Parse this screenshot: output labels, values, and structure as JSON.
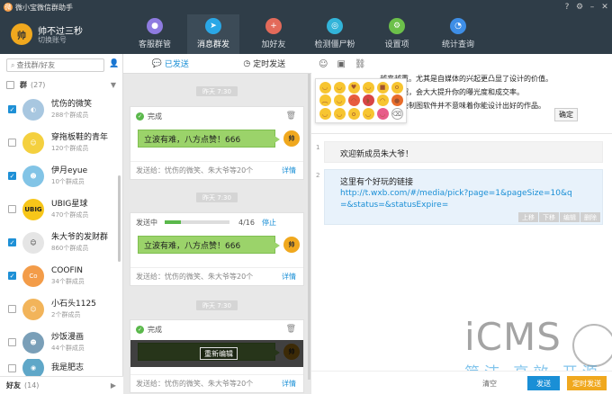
{
  "app": {
    "title": "微小宝微信群助手",
    "logo": "微"
  },
  "user": {
    "name": "帅不过三秒",
    "switch_label": "切换账号"
  },
  "nav": [
    {
      "label": "客服群管",
      "icon": "person-icon",
      "color": "#8e7be0"
    },
    {
      "label": "消息群发",
      "icon": "send-icon",
      "color": "#2aa7e6"
    },
    {
      "label": "加好友",
      "icon": "add-friend-icon",
      "color": "#e36a5a"
    },
    {
      "label": "检测僵尸粉",
      "icon": "scan-icon",
      "color": "#32b4d9"
    },
    {
      "label": "设置项",
      "icon": "gear-icon",
      "color": "#6cc04a"
    },
    {
      "label": "统计查询",
      "icon": "pie-chart-icon",
      "color": "#3e8ee6"
    }
  ],
  "sidebar": {
    "search_placeholder": "查找群/好友",
    "group_head": {
      "label": "群",
      "count": "(27)"
    },
    "groups": [
      {
        "name": "忧伤的微笑",
        "members": "288个群成员",
        "checked": true,
        "color": "#a8c7e0"
      },
      {
        "name": "穿拖板鞋的青年",
        "members": "120个群成员",
        "checked": false,
        "color": "#f4d03f"
      },
      {
        "name": "伊月eyue",
        "members": "10个群成员",
        "checked": true,
        "color": "#82c4e6"
      },
      {
        "name": "UBIG星球",
        "members": "470个群成员",
        "checked": false,
        "color": "#f7c619"
      },
      {
        "name": "朱大爷的发财群",
        "members": "860个群成员",
        "checked": true,
        "color": "#e5e5e5"
      },
      {
        "name": "COOFIN",
        "members": "34个群成员",
        "checked": true,
        "color": "#f39c49"
      },
      {
        "name": "小石头1125",
        "members": "2个群成员",
        "checked": false,
        "color": "#f2b45a"
      },
      {
        "name": "炒饭漫画",
        "members": "44个群成员",
        "checked": false,
        "color": "#7a9fb8"
      },
      {
        "name": "我是肥志",
        "members": "",
        "checked": false,
        "color": "#5fa7c8"
      }
    ],
    "friends_head": {
      "label": "好友",
      "count": "(14)"
    }
  },
  "middle": {
    "tabs": [
      "已发送",
      "定时发送"
    ],
    "items": [
      {
        "time": "昨天 7:30",
        "status": "完成",
        "message": "立波有难，八方点赞！666",
        "footer": "发送给：忧伤的微笑、朱大爷等20个",
        "detail": "详情"
      },
      {
        "time": "昨天 7:30",
        "status": "发送中",
        "progress": 0.25,
        "count": "4/16",
        "stop": "停止",
        "message": "立波有难，八方点赞！666",
        "footer": "发送给：忧伤的微笑、朱大爷等20个",
        "detail": "详情"
      },
      {
        "time": "昨天 7:30",
        "status": "完成",
        "reedit": "重新编辑",
        "footer": "发送给：忧伤的微笑、朱大爷等20个",
        "detail": "详情"
      }
    ],
    "avatar_label": "帅"
  },
  "right": {
    "editor_lines": [
      "越来越重。尤其是自媒体的兴起更凸显了设计的价值。",
      "产品介绍，会大大提升你的曝光度和成交率。",
      "仅汉学会制图软件并不意味着你能设计出好的作品。"
    ],
    "confirm": "确定",
    "messages": [
      {
        "num": "1",
        "text": "欢迎新成员朱大爷！"
      },
      {
        "num": "2",
        "text": "这里有个好玩的链接",
        "url": "http://t.wxb.com/#/media/pick?page=1&pageSize=10&q=&status=&statusExpire=",
        "actions": [
          "上移",
          "下移",
          "编辑",
          "删除"
        ]
      }
    ],
    "bottom": {
      "clear": "清空",
      "send": "发送",
      "send_timed": "定时发送"
    },
    "watermark": {
      "big": "iCMS",
      "cn": "简洁 高效 开源"
    }
  }
}
